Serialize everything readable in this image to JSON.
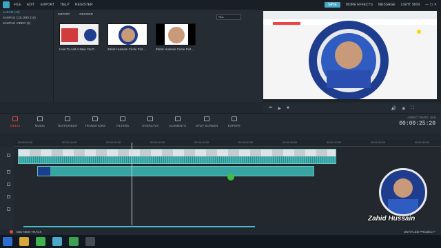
{
  "menu": [
    "FILE",
    "EDIT",
    "EXPORT",
    "HELP",
    "REGISTER"
  ],
  "top_right": {
    "save": "SAVE",
    "more_effects": "MORE EFFECTS",
    "message": "MESSAGE",
    "light_skin": "LIGHT SKIN"
  },
  "album": {
    "items": [
      "ALBUM (29)",
      "SAMPLE COLORS (10)",
      "SAMPLE VIDEO (9)"
    ]
  },
  "library": {
    "import": "IMPORT",
    "record": "RECORD",
    "filter": "ALL",
    "items": [
      {
        "caption": "How To Add A New YouT..."
      },
      {
        "caption": "Zahid Hussain Circle Pict..."
      },
      {
        "caption": "Zahid Hussain Circle Pict..."
      }
    ]
  },
  "tools": [
    "MEDIA",
    "MUSIC",
    "TEXT/CREDIT",
    "TRANSITIONS",
    "FILTERS",
    "OVERLAYS",
    "ELEMENTS",
    "SPLIT SCREEN",
    "EXPORT"
  ],
  "aspect_ratio": "ASPECT RATIO: 16:9",
  "timecode": "00:00:25:20",
  "ruler": [
    "00:00:00:00",
    "00:00:10:00",
    "00:00:20:00",
    "00:00:30:00",
    "00:00:40:00",
    "00:00:50:00",
    "00:01:00:00",
    "00:01:10:00",
    "00:01:20:00",
    "00:01:30:00"
  ],
  "footer": {
    "add_track": "ADD NEW TRACK",
    "project": "UNTITLED PROJECT*"
  },
  "watermark": "Zahid Hussain",
  "colors": {
    "accent": "#4aa8c8",
    "media_active": "#e24b41",
    "clip": "#3aa7a5"
  }
}
